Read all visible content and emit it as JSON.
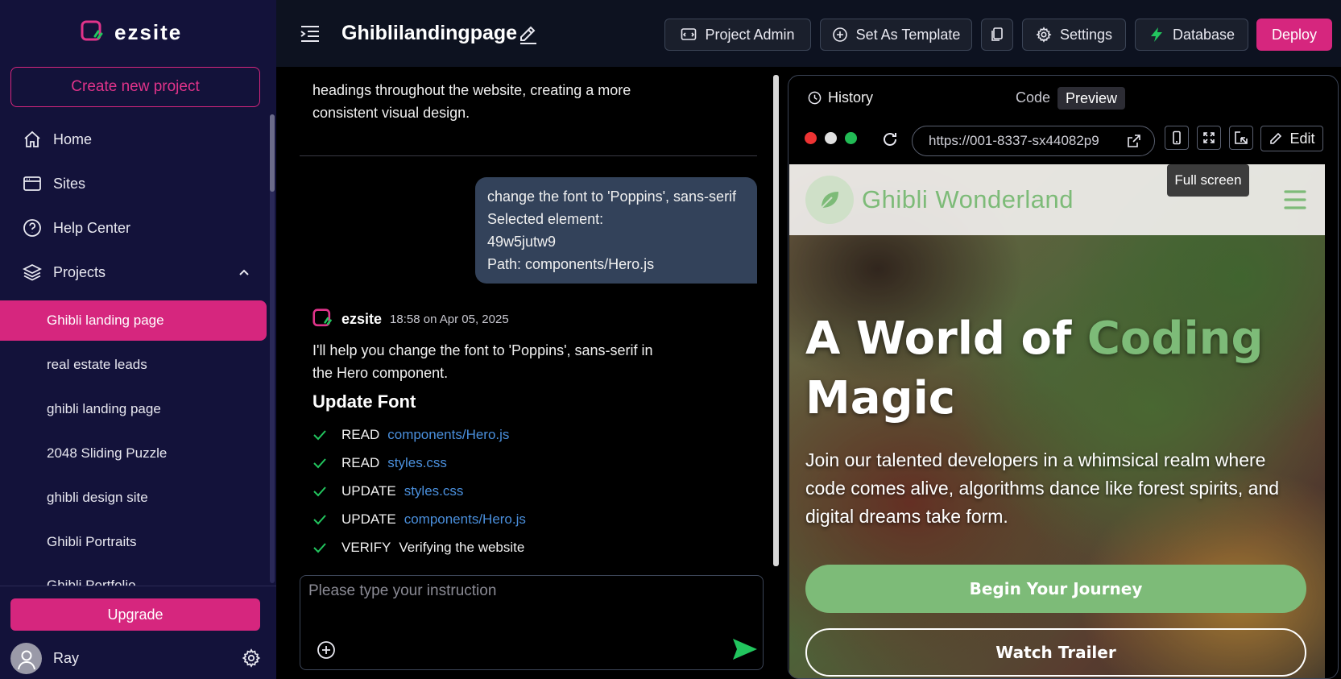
{
  "sidebar": {
    "brand": "ezsite",
    "create_label": "Create new project",
    "nav": {
      "home": "Home",
      "sites": "Sites",
      "help": "Help Center",
      "projects": "Projects"
    },
    "projects": [
      "Ghibli landing page",
      "real estate leads",
      "ghibli landing page",
      "2048 Sliding Puzzle",
      "ghibli design site",
      "Ghibli Portraits",
      "Ghibli Portfolio"
    ],
    "active_project_index": 0,
    "upgrade_label": "Upgrade",
    "user_name": "Ray"
  },
  "topbar": {
    "title": "Ghiblilandingpage",
    "project_admin": "Project Admin",
    "set_template": "Set As Template",
    "settings": "Settings",
    "database": "Database",
    "deploy": "Deploy"
  },
  "chat": {
    "prev_message": "headings throughout the website, creating a more consistent visual design.",
    "user_bubble": {
      "line1": "change the font to 'Poppins', sans-serif",
      "line2": "Selected element:",
      "line3": "49w5jutw9",
      "line4": "Path: components/Hero.js"
    },
    "assistant": {
      "name": "ezsite",
      "time": "18:58 on Apr 05, 2025",
      "reply": "I'll help you change the font to 'Poppins', sans-serif in the Hero component.",
      "section_title": "Update Font",
      "steps": [
        {
          "action": "READ",
          "target": "components/Hero.js"
        },
        {
          "action": "READ",
          "target": "styles.css"
        },
        {
          "action": "UPDATE",
          "target": "styles.css"
        },
        {
          "action": "UPDATE",
          "target": "components/Hero.js"
        },
        {
          "action": "VERIFY",
          "target": "Verifying the website"
        }
      ]
    },
    "input_placeholder": "Please type your instruction"
  },
  "preview": {
    "history": "History",
    "code_tab": "Code",
    "preview_tab": "Preview",
    "url": "https://001-8337-sx44082p9",
    "edit": "Edit",
    "tooltip": "Full screen",
    "colors": {
      "red": "#ee3333",
      "grey": "#e0e0e0",
      "green": "#22bb55"
    },
    "site": {
      "brand": "Ghibli Wonderland",
      "title_part1": "A World of ",
      "title_accent": "Coding",
      "title_part2": "Magic",
      "subtitle": "Join our talented developers in a whimsical realm where code comes alive, algorithms dance like forest spirits, and digital dreams take form.",
      "btn_primary": "Begin Your Journey",
      "btn_secondary": "Watch Trailer",
      "accent_color": "#7dbb78"
    }
  },
  "colors": {
    "brand_pink": "#d6267e",
    "sidebar_bg": "#13123a",
    "link_blue": "#4a8fdc",
    "check_green": "#22c55e"
  }
}
